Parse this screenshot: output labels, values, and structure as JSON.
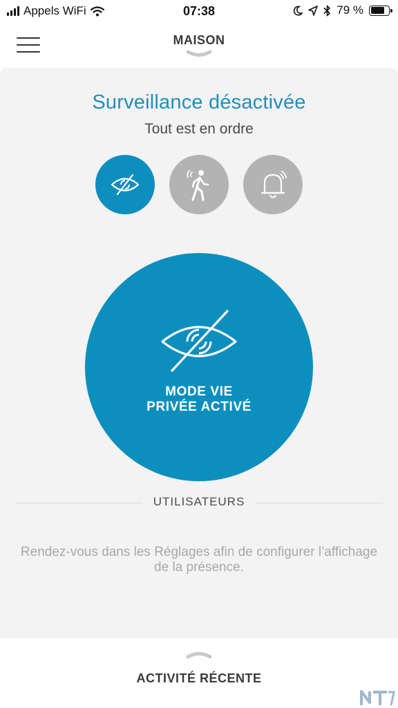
{
  "status_bar": {
    "carrier": "Appels WiFi",
    "time": "07:38",
    "battery": "79 %",
    "battery_level": 0.79
  },
  "nav": {
    "title": "MAISON"
  },
  "main": {
    "headline": "Surveillance désactivée",
    "subline": "Tout est en ordre",
    "modes": [
      {
        "icon": "eye-off-icon",
        "state": "active"
      },
      {
        "icon": "motion-walker-icon",
        "state": "inactive"
      },
      {
        "icon": "bell-alarm-icon",
        "state": "inactive"
      }
    ],
    "big_button": {
      "line1": "MODE VIE",
      "line2": "PRIVÉE ACTIVÉ"
    },
    "section_title": "UTILISATEURS",
    "hint": "Rendez-vous dans les Réglages afin de configurer l’affichage de la présence."
  },
  "bottom": {
    "title": "ACTIVITÉ RÉCENTE"
  },
  "colors": {
    "accent": "#0d8fbe",
    "headline": "#1f8ebd",
    "inactive": "#b3b3b3",
    "background": "#f3f3f3"
  }
}
